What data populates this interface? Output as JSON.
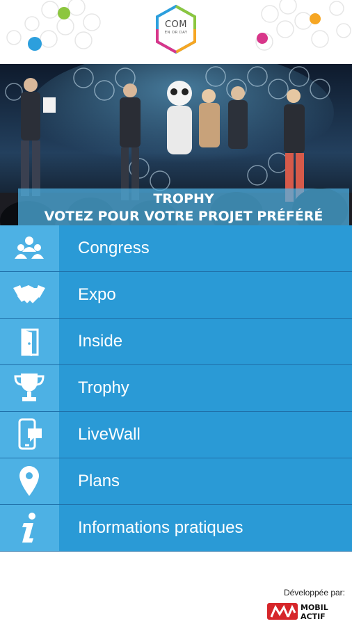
{
  "app": {
    "logo_line1": "COM",
    "logo_line2": "EN OR DAY"
  },
  "banner": {
    "line1": "TROPHY",
    "line2": "VOTEZ POUR VOTRE PROJET PRÉFÉRÉ"
  },
  "menu": [
    {
      "label": "Congress",
      "icon": "group-icon"
    },
    {
      "label": "Expo",
      "icon": "handshake-icon"
    },
    {
      "label": "Inside",
      "icon": "door-icon"
    },
    {
      "label": "Trophy",
      "icon": "trophy-icon"
    },
    {
      "label": "LiveWall",
      "icon": "phone-chat-icon"
    },
    {
      "label": "Plans",
      "icon": "map-pin-icon"
    },
    {
      "label": "Informations pratiques",
      "icon": "info-icon"
    }
  ],
  "footer": {
    "developed_by": "Développée par:",
    "brand_line1": "MOBIL",
    "brand_line2": "ACTIF"
  },
  "colors": {
    "menu_bg": "#2a9ad6",
    "icon_bg": "#4db1e4",
    "divider": "#1f6fa8"
  }
}
